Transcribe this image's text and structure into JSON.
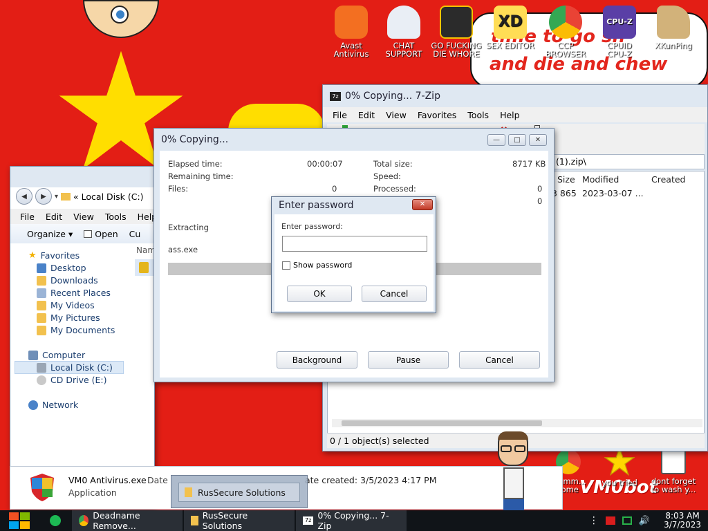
{
  "desktop": {
    "icons": [
      {
        "label": "Avast\nAntivirus",
        "icon": "avast-icon",
        "color": "#f36f21"
      },
      {
        "label": "CHAT\nSUPPORT",
        "icon": "doctor-icon",
        "color": "#e9eef5"
      },
      {
        "label": "GO FUCKING\nDIE WHORE",
        "icon": "davinci-icon",
        "color": "#2b2b2b"
      },
      {
        "label": "SEX EDITOR",
        "icon": "xd-icon",
        "color": "#ffdd55"
      },
      {
        "label": "CCP\nBROWSER",
        "icon": "chrome-icon",
        "color": "#e9d41c"
      },
      {
        "label": "CPUID\nCPU-Z",
        "icon": "cpuz-icon",
        "color": "#5a3fa6"
      },
      {
        "label": "XKunPing",
        "icon": "kunping-icon",
        "color": "#d2b27a"
      },
      {
        "label": "you tried",
        "icon": "star-icon",
        "color": "#ffd800"
      },
      {
        "label": "dont forget\nto wash y...",
        "icon": "calendar-icon",
        "color": "#ffffff"
      },
      {
        "label": "ommm...\nrome",
        "icon": "chrome-small-icon",
        "color": "#2a7be4"
      }
    ],
    "wallpaper_text": [
      "time to go sh",
      "and die and chew"
    ],
    "watermark": "VM0bot",
    "colors": {
      "flag_red": "#e31e15",
      "star_yellow": "#ffde00"
    }
  },
  "explorer": {
    "breadcrumb": "«  Local Disk (C:)",
    "menu": [
      "File",
      "Edit",
      "View",
      "Tools",
      "Help"
    ],
    "toolbar": {
      "organize": "Organize ▾",
      "open": "Open",
      "cut": "Cu"
    },
    "column_name": "Nam",
    "tree": {
      "favorites": "Favorites",
      "fav_items": [
        "Desktop",
        "Downloads",
        "Recent Places",
        "My Videos",
        "My Pictures",
        "My Documents"
      ],
      "computer": "Computer",
      "computer_items": [
        "Local Disk (C:)",
        "CD Drive (E:)"
      ],
      "network": "Network"
    },
    "details": {
      "filename": "VM0 Antivirus.exe",
      "type": "Application",
      "date_label": "Date",
      "created_text": "ate created:  3/5/2023 4:17 PM"
    },
    "tooltip": "RusSecure Solutions"
  },
  "sevenzip": {
    "title": "0% Copying... 7-Zip",
    "menu": [
      "File",
      "Edit",
      "View",
      "Favorites",
      "Tools",
      "Help"
    ],
    "path": "(1).zip\\",
    "columns": [
      "Size",
      "Modified",
      "Created"
    ],
    "row": {
      "size": "3 865",
      "modified": "2023-03-07 ..."
    },
    "status": "0 / 1 object(s) selected"
  },
  "progress": {
    "title": "0% Copying...",
    "elapsed_label": "Elapsed time:",
    "elapsed_value": "00:00:07",
    "remaining_label": "Remaining time:",
    "files_label": "Files:",
    "files_value": "0",
    "total_label": "Total size:",
    "total_value": "8717 KB",
    "speed_label": "Speed:",
    "processed_label": "Processed:",
    "processed_value": "0",
    "extra_value": "0",
    "operation": "Extracting",
    "current_file": "ass.exe",
    "percent": 0,
    "buttons": {
      "background": "Background",
      "pause": "Pause",
      "cancel": "Cancel"
    }
  },
  "password_dialog": {
    "title": "Enter password",
    "prompt": "Enter password:",
    "value": "",
    "show_password": "Show password",
    "ok": "OK",
    "cancel": "Cancel"
  },
  "taskbar": {
    "items": [
      "Deadname Remove...",
      "RusSecure Solutions",
      "0% Copying... 7-Zip"
    ],
    "time": "8:03 AM",
    "date": "3/7/2023"
  }
}
